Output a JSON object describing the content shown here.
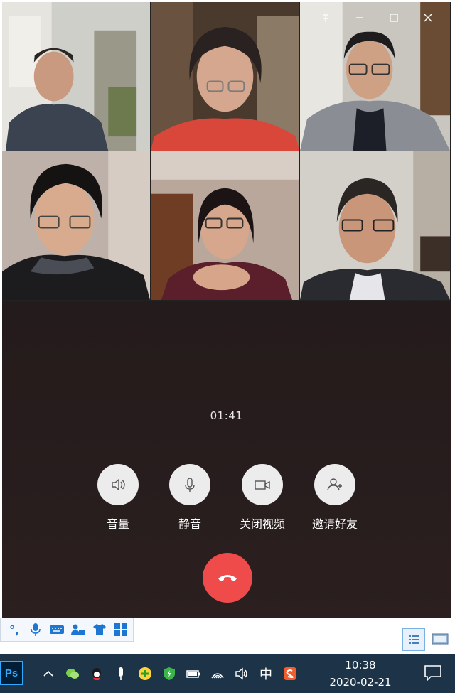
{
  "window": {
    "controls": [
      {
        "name": "pin",
        "icon": "pin-icon"
      },
      {
        "name": "minimize",
        "icon": "minimize-icon"
      },
      {
        "name": "maximize",
        "icon": "maximize-icon"
      },
      {
        "name": "close",
        "icon": "close-icon"
      }
    ]
  },
  "participants": [
    {
      "id": 1,
      "icon": "video-feed"
    },
    {
      "id": 2,
      "icon": "video-feed"
    },
    {
      "id": 3,
      "icon": "video-feed"
    },
    {
      "id": 4,
      "icon": "video-feed"
    },
    {
      "id": 5,
      "icon": "video-feed"
    },
    {
      "id": 6,
      "icon": "video-feed"
    }
  ],
  "call": {
    "duration": "01:41",
    "controls": {
      "volume": "音量",
      "mute": "静音",
      "video_off": "关闭视频",
      "invite": "邀请好友"
    },
    "hangup_icon": "hangup-icon",
    "hangup_color": "#f04b4b"
  },
  "ime": {
    "punct": "°,",
    "icons": [
      "mic-icon",
      "keyboard-icon",
      "user-ime-icon",
      "shirt-icon",
      "grid-icon"
    ]
  },
  "taskbar": {
    "app": "Ps",
    "ime_language": "中",
    "time": "10:38",
    "date": "2020-02-21",
    "tray_icons": [
      "chevron-up-icon",
      "wechat-icon",
      "qq-icon",
      "microphone-icon",
      "plus-icon",
      "shield-icon",
      "battery-icon",
      "wifi-icon",
      "volume-icon",
      "ime-lang-icon",
      "sogou-icon"
    ]
  },
  "colors": {
    "taskbar": "#1c3348",
    "call_background": "#261c1d",
    "control_circle": "#ececec"
  }
}
